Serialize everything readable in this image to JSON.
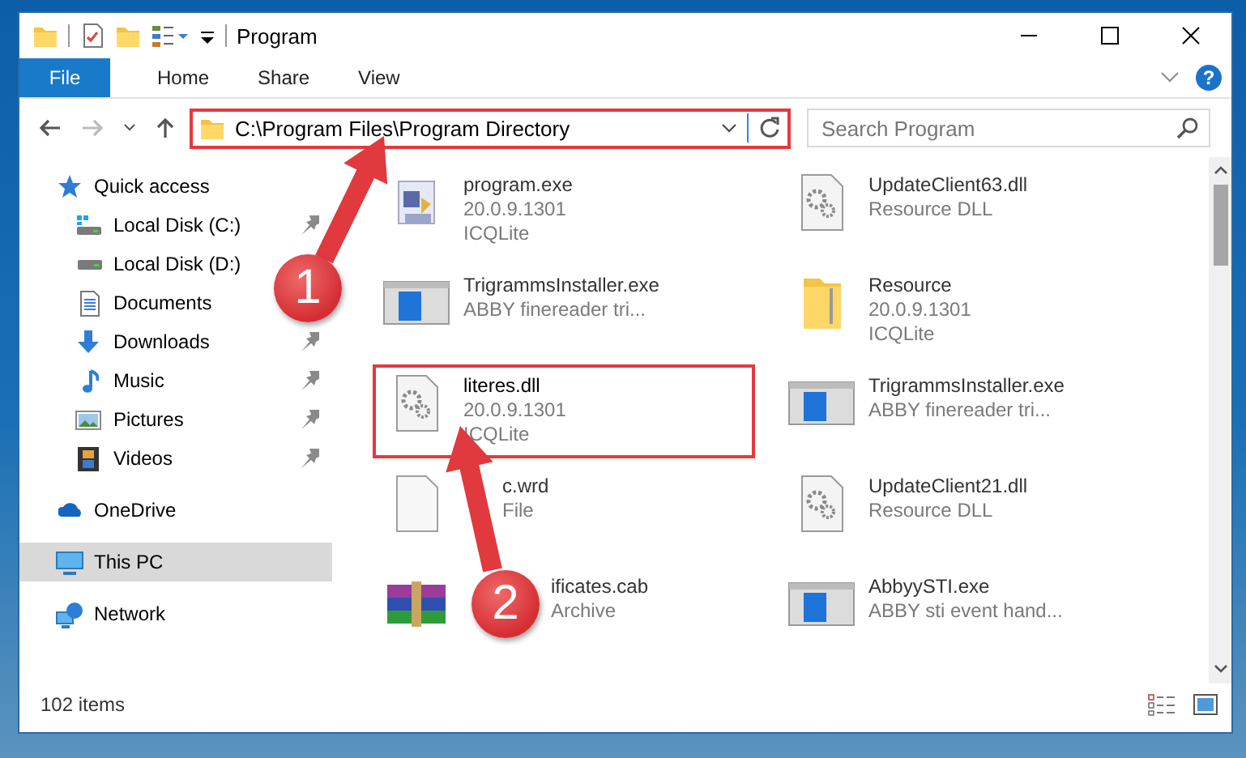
{
  "window": {
    "title": "Program"
  },
  "ribbon": {
    "tabs": [
      {
        "label": "File",
        "kind": "file"
      },
      {
        "label": "Home",
        "kind": "tab"
      },
      {
        "label": "Share",
        "kind": "tab"
      },
      {
        "label": "View",
        "kind": "tab"
      }
    ],
    "help_label": "?"
  },
  "address_bar": {
    "path": "C:\\Program Files\\Program Directory",
    "highlighted": true
  },
  "search": {
    "placeholder": "Search Program"
  },
  "navigation": [
    {
      "label": "Quick access",
      "kind": "star",
      "selected": false,
      "children": [
        {
          "label": "Local Disk (C:)",
          "kind": "system-drive",
          "pinned": true,
          "selected": false
        },
        {
          "label": "Local Disk (D:)",
          "kind": "drive",
          "pinned": false,
          "selected": false
        },
        {
          "label": "Documents",
          "kind": "documents",
          "pinned": false,
          "selected": false
        },
        {
          "label": "Downloads",
          "kind": "downloads",
          "pinned": true,
          "selected": false
        },
        {
          "label": "Music",
          "kind": "music",
          "pinned": true,
          "selected": false
        },
        {
          "label": "Pictures",
          "kind": "pictures",
          "pinned": true,
          "selected": false
        },
        {
          "label": "Videos",
          "kind": "videos",
          "pinned": true,
          "selected": false
        }
      ]
    },
    {
      "label": "OneDrive",
      "kind": "cloud",
      "selected": false
    },
    {
      "label": "This PC",
      "kind": "pc",
      "selected": true
    },
    {
      "label": "Network",
      "kind": "network",
      "selected": false
    }
  ],
  "files": [
    {
      "name": "program.exe",
      "details": [
        "20.0.9.1301",
        "ICQLite"
      ],
      "kind": "setup",
      "highlighted": false
    },
    {
      "name": "UpdateClient63.dll",
      "details": [
        "Resource DLL"
      ],
      "kind": "dll",
      "highlighted": false
    },
    {
      "name": "TrigrammsInstaller.exe",
      "details": [
        "ABBY finereader tri..."
      ],
      "kind": "window",
      "highlighted": false
    },
    {
      "name": "Resource",
      "details": [
        "20.0.9.1301",
        "ICQLite"
      ],
      "kind": "folder",
      "highlighted": false
    },
    {
      "name": "literes.dll",
      "details": [
        "20.0.9.1301",
        "ICQLite"
      ],
      "kind": "dll",
      "highlighted": true
    },
    {
      "name": "TrigrammsInstaller.exe",
      "details": [
        "ABBY finereader tri..."
      ],
      "kind": "window",
      "highlighted": false
    },
    {
      "name": "c.wrd",
      "details": [
        "File"
      ],
      "kind": "document",
      "highlighted": false
    },
    {
      "name": "UpdateClient21.dll",
      "details": [
        "Resource DLL"
      ],
      "kind": "dll",
      "highlighted": false
    },
    {
      "name": "ificates.cab",
      "details": [
        "Archive"
      ],
      "kind": "archive",
      "highlighted": false
    },
    {
      "name": "AbbyySTI.exe",
      "details": [
        "ABBY sti event hand..."
      ],
      "kind": "window",
      "highlighted": false
    }
  ],
  "status_bar": {
    "item_count": "102 items"
  },
  "annotations": [
    {
      "label": "1"
    },
    {
      "label": "2"
    }
  ]
}
